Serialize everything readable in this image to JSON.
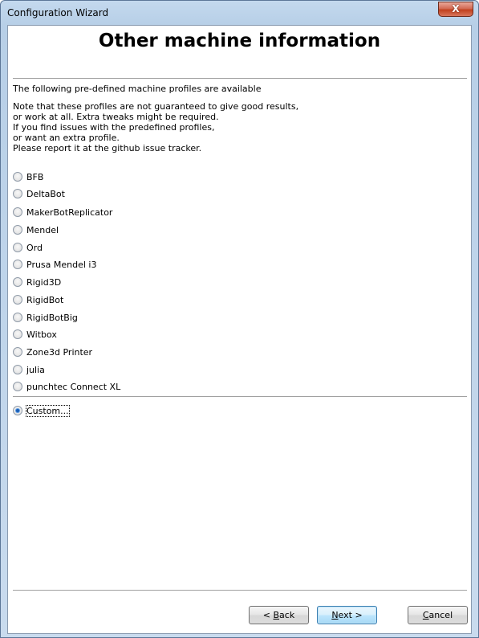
{
  "window": {
    "title": "Configuration Wizard",
    "close_symbol": "X"
  },
  "page": {
    "title": "Other machine information",
    "intro": "The following pre-defined machine profiles are available",
    "note_lines": [
      "Note that these profiles are not guaranteed to give good results,",
      "or work at all. Extra tweaks might be required.",
      "If you find issues with the predefined profiles,",
      "or want an extra profile.",
      "Please report it at the github issue tracker."
    ]
  },
  "profiles": [
    {
      "label": "BFB",
      "selected": false
    },
    {
      "label": "DeltaBot",
      "selected": false
    },
    {
      "label": "MakerBotReplicator",
      "selected": false
    },
    {
      "label": "Mendel",
      "selected": false
    },
    {
      "label": "Ord",
      "selected": false
    },
    {
      "label": "Prusa Mendel i3",
      "selected": false
    },
    {
      "label": "Rigid3D",
      "selected": false
    },
    {
      "label": "RigidBot",
      "selected": false
    },
    {
      "label": "RigidBotBig",
      "selected": false
    },
    {
      "label": "Witbox",
      "selected": false
    },
    {
      "label": "Zone3d Printer",
      "selected": false
    },
    {
      "label": "julia",
      "selected": false
    },
    {
      "label": "punchtec Connect XL",
      "selected": false
    }
  ],
  "custom_option": {
    "label": "Custom...",
    "selected": true
  },
  "buttons": {
    "back": {
      "prefix": "< ",
      "mnemonic": "B",
      "rest": "ack"
    },
    "next": {
      "mnemonic": "N",
      "rest": "ext >"
    },
    "cancel": {
      "mnemonic": "C",
      "rest": "ancel"
    }
  }
}
